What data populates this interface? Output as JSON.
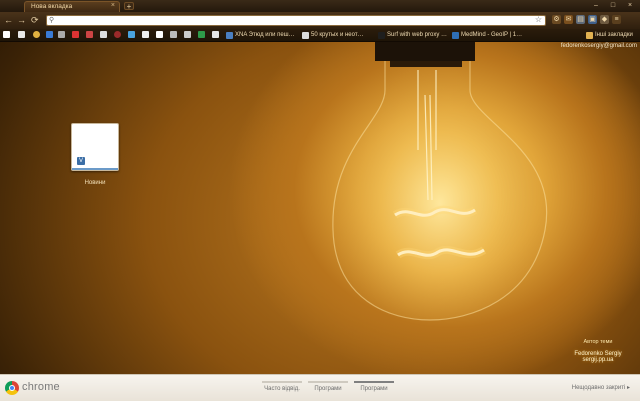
{
  "window": {
    "tab_title": "Нова вкладка",
    "tab_close_glyph": "×",
    "new_tab_glyph": "+",
    "controls": [
      "–",
      "□",
      "×"
    ]
  },
  "toolbar": {
    "back_glyph": "←",
    "forward_glyph": "→",
    "reload_glyph": "⟳",
    "omnibox_value": "",
    "omnibox_placeholder": "",
    "star_glyph": "☆"
  },
  "bookmarks": {
    "items": [
      {
        "label": "XNA Этюд или пеш…",
        "icon_color": "#4a7fc1",
        "icon_text": "X"
      },
      {
        "label": "50 крутых и неот…",
        "icon_color": "#dcdcdc",
        "icon_text": "A"
      },
      {
        "label": "Surf with web proxy …",
        "icon_color": "#1e1e1e",
        "icon_text": ""
      },
      {
        "label": "MedMind - GeoIP | 1…",
        "icon_color": "#2f6fb5",
        "icon_text": ""
      }
    ],
    "other_label": "Інші закладки"
  },
  "user": {
    "email": "fedorenkosergiy@gmail.com"
  },
  "most_visited": [
    {
      "title": "Новини",
      "favicon_text": "V"
    }
  ],
  "credit": {
    "author_label": "Автор теми",
    "name": "Fedorenko Sergiy",
    "site": "sergij.pp.ua"
  },
  "footer": {
    "brand": "chrome",
    "tabs": [
      {
        "label": "Часто відвід.",
        "active": false
      },
      {
        "label": "Програми",
        "active": false
      },
      {
        "label": "Програми",
        "active": true
      }
    ],
    "recently_closed": "Нещодавно закриті ▸"
  },
  "colors": {
    "accent": "#e2a63a",
    "frame": "#3a2a18",
    "footer_bg": "#f2eee6"
  }
}
